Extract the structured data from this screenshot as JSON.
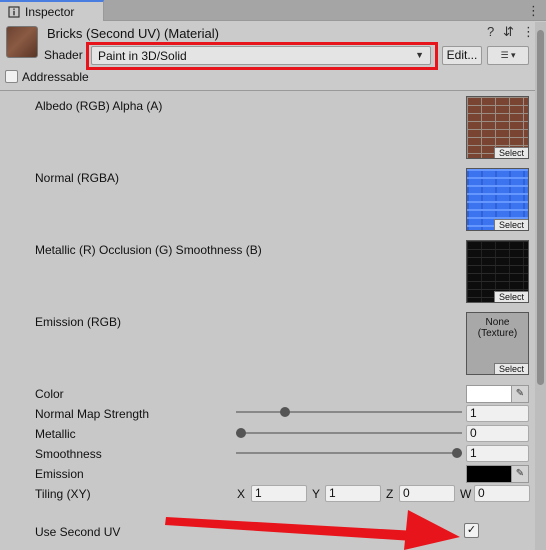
{
  "tab": {
    "title": "Inspector"
  },
  "header": {
    "material_title": "Bricks (Second UV) (Material)",
    "help_icon": "?",
    "settings_icon": "⇵",
    "menu_icon": "⋮",
    "shader_label": "Shader",
    "shader_value": "Paint in 3D/Solid",
    "edit_label": "Edit...",
    "list_icon": "☰ ▾",
    "addressable_label": "Addressable",
    "highlight_color": "#e8141b"
  },
  "props": {
    "albedo_label": "Albedo (RGB) Alpha (A)",
    "normal_label": "Normal (RGBA)",
    "metallic_tex_label": "Metallic (R) Occlusion (G) Smoothness (B)",
    "emission_tex_label": "Emission (RGB)",
    "select_label": "Select",
    "none_label": "None",
    "texture_label": "(Texture)",
    "color_label": "Color",
    "color_value": "#ffffff",
    "normal_strength_label": "Normal Map Strength",
    "normal_strength_value": "1",
    "metallic_label": "Metallic",
    "metallic_value": "0",
    "smoothness_label": "Smoothness",
    "smoothness_value": "1",
    "emission_label": "Emission",
    "emission_value": "#000000",
    "tiling_label": "Tiling (XY)",
    "tiling": [
      {
        "axis": "X",
        "value": "1"
      },
      {
        "axis": "Y",
        "value": "1"
      },
      {
        "axis": "Z",
        "value": "0"
      },
      {
        "axis": "W",
        "value": "0"
      }
    ],
    "second_uv_label": "Use Second UV",
    "second_uv_check": "✓"
  },
  "annotation": {
    "arrow_color": "#e8141b"
  }
}
